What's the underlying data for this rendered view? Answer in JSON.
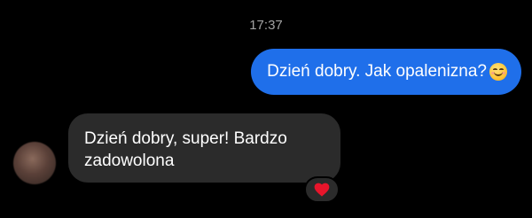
{
  "chat": {
    "timestamp": "17:37",
    "messages": [
      {
        "direction": "outgoing",
        "text": "Dzień dobry. Jak opalenizna?",
        "emoji": "smiling-face-emoji",
        "bubble_color": "#1f6fea"
      },
      {
        "direction": "incoming",
        "text": "Dzień dobry, super! Bardzo zadowolona",
        "bubble_color": "#2b2b2b",
        "reaction": "heart-icon",
        "reaction_color": "#e8152b"
      }
    ]
  }
}
